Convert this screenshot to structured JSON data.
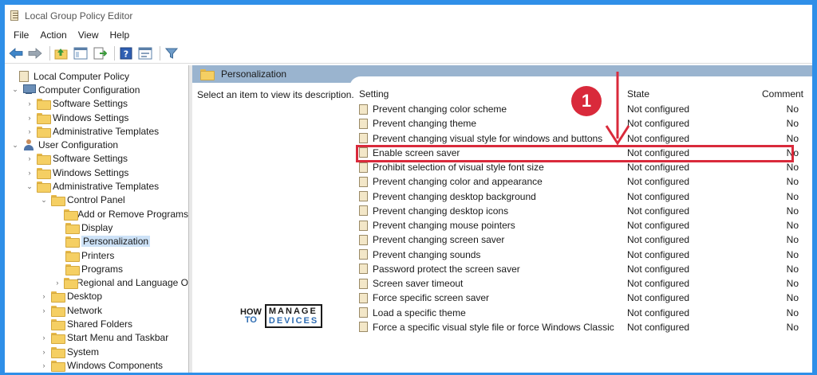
{
  "window": {
    "title": "Local Group Policy Editor"
  },
  "menu": [
    "File",
    "Action",
    "View",
    "Help"
  ],
  "toolbar": {
    "icons": [
      "back-arrow-icon",
      "forward-arrow-icon",
      "up-folder-icon",
      "show-hide-tree-icon",
      "export-list-icon",
      "help-icon",
      "properties-icon",
      "filter-icon"
    ]
  },
  "tree": {
    "items": [
      {
        "label": "Local Computer Policy",
        "level": 0,
        "icon": "policy-doc-icon",
        "chevron": ""
      },
      {
        "label": "Computer Configuration",
        "level": 1,
        "icon": "computer-icon",
        "chevron": "⌄"
      },
      {
        "label": "Software Settings",
        "level": 2,
        "icon": "folder-icon",
        "chevron": "›"
      },
      {
        "label": "Windows Settings",
        "level": 2,
        "icon": "folder-icon",
        "chevron": "›"
      },
      {
        "label": "Administrative Templates",
        "level": 2,
        "icon": "folder-icon",
        "chevron": "›"
      },
      {
        "label": "User Configuration",
        "level": 1,
        "icon": "user-icon",
        "chevron": "⌄"
      },
      {
        "label": "Software Settings",
        "level": 2,
        "icon": "folder-icon",
        "chevron": "›"
      },
      {
        "label": "Windows Settings",
        "level": 2,
        "icon": "folder-icon",
        "chevron": "›"
      },
      {
        "label": "Administrative Templates",
        "level": 2,
        "icon": "folder-icon",
        "chevron": "⌄"
      },
      {
        "label": "Control Panel",
        "level": 3,
        "icon": "folder-icon",
        "chevron": "⌄"
      },
      {
        "label": "Add or Remove Programs",
        "level": 4,
        "icon": "folder-icon",
        "chevron": ""
      },
      {
        "label": "Display",
        "level": 4,
        "icon": "folder-icon",
        "chevron": ""
      },
      {
        "label": "Personalization",
        "level": 4,
        "icon": "folder-icon",
        "chevron": "",
        "selected": true
      },
      {
        "label": "Printers",
        "level": 4,
        "icon": "folder-icon",
        "chevron": ""
      },
      {
        "label": "Programs",
        "level": 4,
        "icon": "folder-icon",
        "chevron": ""
      },
      {
        "label": "Regional and Language O",
        "level": 4,
        "icon": "folder-icon",
        "chevron": "›"
      },
      {
        "label": "Desktop",
        "level": 3,
        "icon": "folder-icon",
        "chevron": "›"
      },
      {
        "label": "Network",
        "level": 3,
        "icon": "folder-icon",
        "chevron": "›"
      },
      {
        "label": "Shared Folders",
        "level": 3,
        "icon": "folder-icon",
        "chevron": ""
      },
      {
        "label": "Start Menu and Taskbar",
        "level": 3,
        "icon": "folder-icon",
        "chevron": "›"
      },
      {
        "label": "System",
        "level": 3,
        "icon": "folder-icon",
        "chevron": "›"
      },
      {
        "label": "Windows Components",
        "level": 3,
        "icon": "folder-icon",
        "chevron": "›"
      }
    ]
  },
  "right": {
    "header_title": "Personalization",
    "description": "Select an item to view its description.",
    "columns": {
      "setting": "Setting",
      "state": "State",
      "comment": "Comment"
    },
    "rows": [
      {
        "setting": "Prevent changing color scheme",
        "state": "Not configured",
        "comment": "No"
      },
      {
        "setting": "Prevent changing theme",
        "state": "Not configured",
        "comment": "No"
      },
      {
        "setting": "Prevent changing visual style for windows and buttons",
        "state": "Not configured",
        "comment": "No"
      },
      {
        "setting": "Enable screen saver",
        "state": "Not configured",
        "comment": "No",
        "highlighted": true
      },
      {
        "setting": "Prohibit selection of visual style font size",
        "state": "Not configured",
        "comment": "No"
      },
      {
        "setting": "Prevent changing color and appearance",
        "state": "Not configured",
        "comment": "No"
      },
      {
        "setting": "Prevent changing desktop background",
        "state": "Not configured",
        "comment": "No"
      },
      {
        "setting": "Prevent changing desktop icons",
        "state": "Not configured",
        "comment": "No"
      },
      {
        "setting": "Prevent changing mouse pointers",
        "state": "Not configured",
        "comment": "No"
      },
      {
        "setting": "Prevent changing screen saver",
        "state": "Not configured",
        "comment": "No"
      },
      {
        "setting": "Prevent changing sounds",
        "state": "Not configured",
        "comment": "No"
      },
      {
        "setting": "Password protect the screen saver",
        "state": "Not configured",
        "comment": "No"
      },
      {
        "setting": "Screen saver timeout",
        "state": "Not configured",
        "comment": "No"
      },
      {
        "setting": "Force specific screen saver",
        "state": "Not configured",
        "comment": "No"
      },
      {
        "setting": "Load a specific theme",
        "state": "Not configured",
        "comment": "No"
      },
      {
        "setting": "Force a specific visual style file or force Windows Classic",
        "state": "Not configured",
        "comment": "No"
      }
    ]
  },
  "annotation": {
    "badge_number": "1",
    "color": "#d92a3b"
  },
  "watermark": {
    "line1": "HOW",
    "line2": "TO",
    "line3": "MANAGE",
    "line4": "DEVICES"
  },
  "colors": {
    "frame": "#2f8fe8",
    "header_band": "#9ab4cf",
    "selection": "#cde2f7"
  }
}
